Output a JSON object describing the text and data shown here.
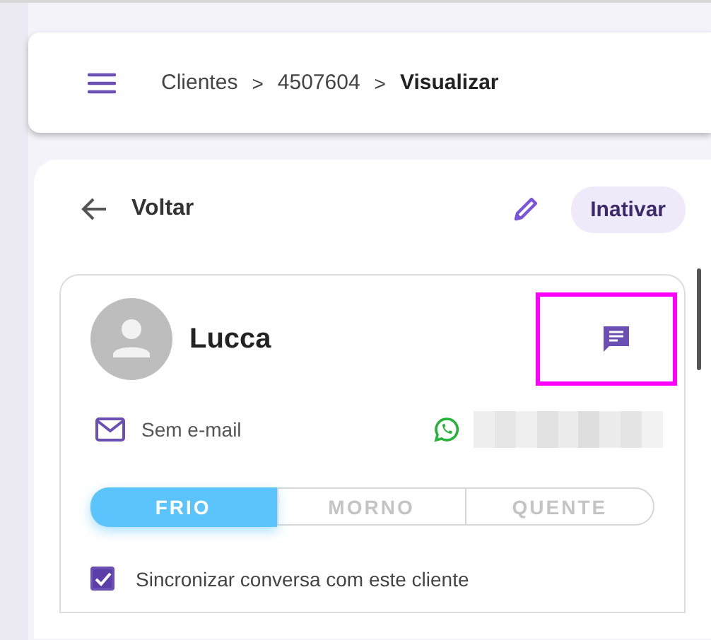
{
  "breadcrumb": [
    {
      "label": "Clientes",
      "current": false
    },
    {
      "label": "4507604",
      "current": false
    },
    {
      "label": "Visualizar",
      "current": true
    }
  ],
  "separator": ">",
  "back": {
    "label": "Voltar"
  },
  "deactivate_button": {
    "label": "Inativar"
  },
  "client": {
    "name": "Lucca",
    "email": "Sem e-mail",
    "phone": {
      "redacted": true
    },
    "chat_button": {
      "highlighted": true
    }
  },
  "temperature": [
    {
      "label": "FRIO",
      "selected": true
    },
    {
      "label": "MORNO",
      "selected": false
    },
    {
      "label": "QUENTE",
      "selected": false
    }
  ],
  "sync": {
    "label": "Sincronizar conversa com este cliente",
    "checked": true
  }
}
